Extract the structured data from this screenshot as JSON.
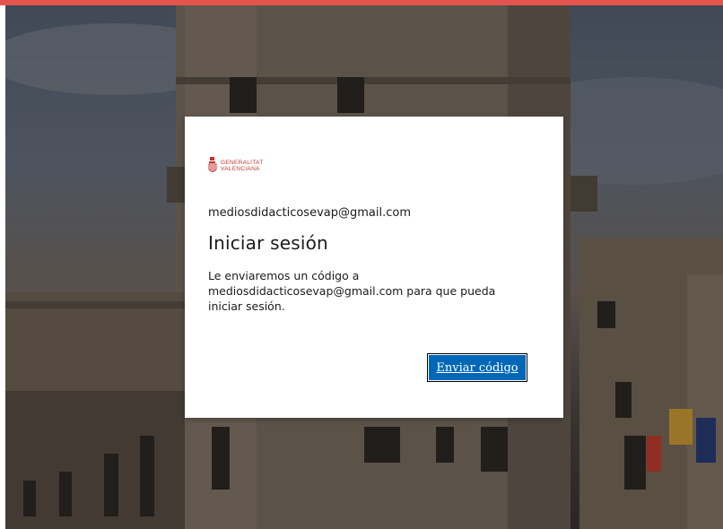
{
  "brand": {
    "line1": "GENERALITAT",
    "line2": "VALENCIANA",
    "accent_color": "#c0352f"
  },
  "signin": {
    "identity": "mediosdidacticosevap@gmail.com",
    "title": "Iniciar sesión",
    "description": "Le enviaremos un código a mediosdidacticosevap@gmail.com para que pueda iniciar sesión.",
    "send_button": "Enviar código"
  },
  "colors": {
    "top_bar": "#e4544f",
    "button": "#0067b8"
  },
  "background_image": "palau-de-la-generalitat-photo"
}
